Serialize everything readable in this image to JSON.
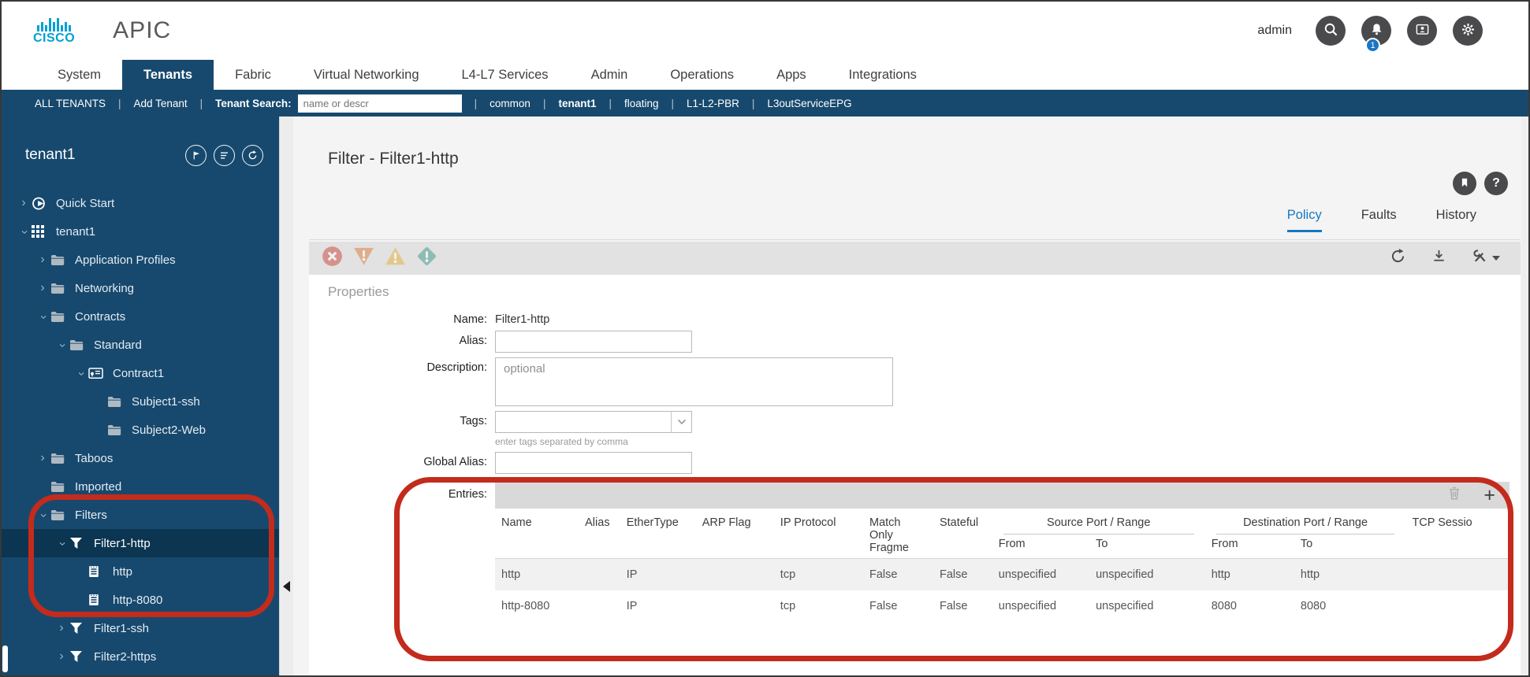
{
  "colors": {
    "navy": "#17496E",
    "navy_selected": "#0B3550",
    "accent_blue": "#1877C0",
    "cisco_blue": "#00A0D6",
    "annotation_red": "#C32B1C",
    "fault_critical": "#CB4A3F",
    "fault_major": "#DF7E3C",
    "fault_minor": "#E2B43C",
    "fault_warning": "#43998D"
  },
  "header": {
    "brand": "cisco",
    "app_title": "APIC",
    "username": "admin",
    "notification_count": "1",
    "icons": [
      "search-icon",
      "bell-icon",
      "contact-icon",
      "gear-icon"
    ]
  },
  "nav": {
    "active": "Tenants",
    "tabs": [
      "System",
      "Tenants",
      "Fabric",
      "Virtual Networking",
      "L4-L7 Services",
      "Admin",
      "Operations",
      "Apps",
      "Integrations"
    ]
  },
  "subnav": {
    "all_tenants": "ALL TENANTS",
    "add_tenant": "Add Tenant",
    "search_label": "Tenant Search:",
    "search_placeholder": "name or descr",
    "active_tenant": "tenant1",
    "tenant_links": [
      "common",
      "tenant1",
      "floating",
      "L1-L2-PBR",
      "L3outServiceEPG"
    ]
  },
  "sidebar": {
    "title": "tenant1",
    "header_icons": [
      "flag-icon",
      "list-icon",
      "refresh-icon"
    ],
    "tree": [
      {
        "label": "Quick Start",
        "level": 0,
        "chevron": "collapsed",
        "icon": "quickstart-icon"
      },
      {
        "label": "tenant1",
        "level": 0,
        "chevron": "expanded",
        "icon": "tenant-icon"
      },
      {
        "label": "Application Profiles",
        "level": 1,
        "chevron": "collapsed",
        "icon": "folder-icon"
      },
      {
        "label": "Networking",
        "level": 1,
        "chevron": "collapsed",
        "icon": "folder-icon"
      },
      {
        "label": "Contracts",
        "level": 1,
        "chevron": "expanded",
        "icon": "folder-icon"
      },
      {
        "label": "Standard",
        "level": 2,
        "chevron": "expanded",
        "icon": "folder-icon"
      },
      {
        "label": "Contract1",
        "level": 3,
        "chevron": "expanded",
        "icon": "contract-icon"
      },
      {
        "label": "Subject1-ssh",
        "level": 4,
        "chevron": "none",
        "icon": "folder-icon"
      },
      {
        "label": "Subject2-Web",
        "level": 4,
        "chevron": "none",
        "icon": "folder-icon"
      },
      {
        "label": "Taboos",
        "level": 1,
        "chevron": "collapsed",
        "icon": "folder-icon"
      },
      {
        "label": "Imported",
        "level": 1,
        "chevron": "none",
        "icon": "folder-icon"
      },
      {
        "label": "Filters",
        "level": 1,
        "chevron": "expanded",
        "icon": "folder-icon"
      },
      {
        "label": "Filter1-http",
        "level": 2,
        "chevron": "expanded",
        "icon": "filter-icon",
        "selected": true
      },
      {
        "label": "http",
        "level": 3,
        "chevron": "none",
        "icon": "entry-icon"
      },
      {
        "label": "http-8080",
        "level": 3,
        "chevron": "none",
        "icon": "entry-icon"
      },
      {
        "label": "Filter1-ssh",
        "level": 2,
        "chevron": "collapsed",
        "icon": "filter-icon"
      },
      {
        "label": "Filter2-https",
        "level": 2,
        "chevron": "collapsed",
        "icon": "filter-icon"
      }
    ]
  },
  "main": {
    "page_title": "Filter - Filter1-http",
    "active_tab": "Policy",
    "tabs": [
      "Policy",
      "Faults",
      "History"
    ],
    "page_icons": [
      "bookmark-icon",
      "help-icon"
    ],
    "fault_icons": [
      "critical-fault-icon",
      "major-fault-icon",
      "minor-fault-icon",
      "warning-fault-icon"
    ],
    "action_icons": [
      "refresh-icon",
      "download-icon",
      "tools-icon"
    ],
    "properties": {
      "section_title": "Properties",
      "name_label": "Name:",
      "name_value": "Filter1-http",
      "alias_label": "Alias:",
      "alias_value": "",
      "description_label": "Description:",
      "description_placeholder": "optional",
      "tags_label": "Tags:",
      "tags_value": "",
      "tags_help": "enter tags separated by comma",
      "global_alias_label": "Global Alias:",
      "global_alias_value": "",
      "entries_label": "Entries:"
    },
    "entries_table": {
      "columns": [
        "Name",
        "Alias",
        "EtherType",
        "ARP Flag",
        "IP Protocol",
        "Match Only Fragme",
        "Stateful"
      ],
      "groups": [
        {
          "label": "Source Port / Range",
          "children": [
            "From",
            "To"
          ]
        },
        {
          "label": "Destination Port / Range",
          "children": [
            "From",
            "To"
          ]
        }
      ],
      "trailing_column": "TCP Sessio",
      "rows": [
        [
          "http",
          "",
          "IP",
          "",
          "tcp",
          "False",
          "False",
          "unspecified",
          "unspecified",
          "http",
          "http",
          ""
        ],
        [
          "http-8080",
          "",
          "IP",
          "",
          "tcp",
          "False",
          "False",
          "unspecified",
          "unspecified",
          "8080",
          "8080",
          ""
        ]
      ]
    }
  }
}
